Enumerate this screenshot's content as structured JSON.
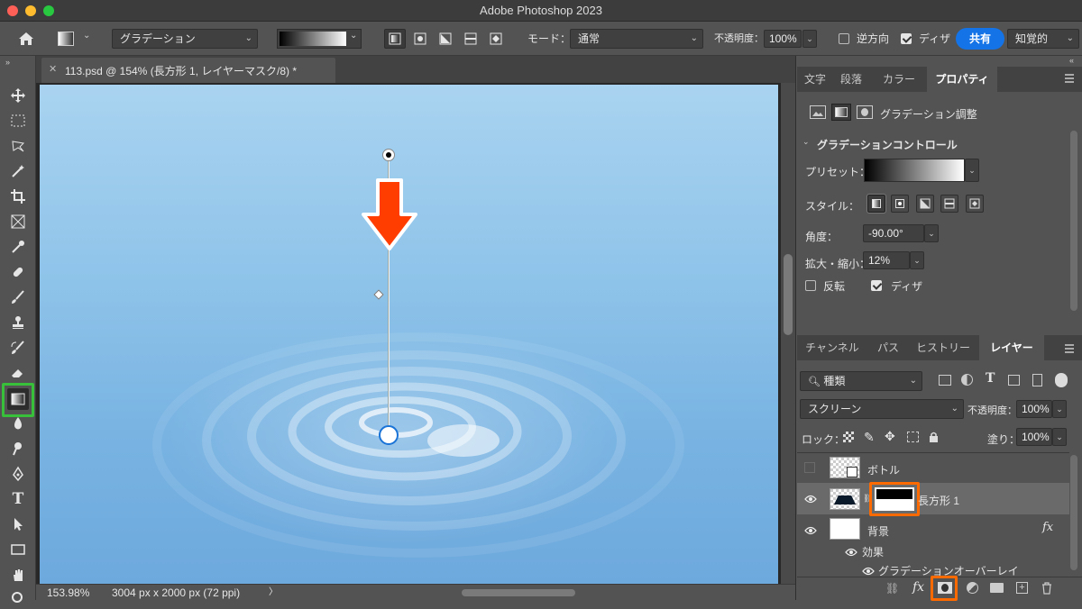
{
  "window": {
    "title": "Adobe Photoshop 2023"
  },
  "options": {
    "gradient_type": "グラデーション",
    "mode_label": "モード：",
    "mode_value": "通常",
    "opacity_label": "不透明度：",
    "opacity_value": "100%",
    "reverse_label": "逆方向",
    "dither_label": "ディザ",
    "share_label": "共有",
    "method_value": "知覚的"
  },
  "document": {
    "tab_title": "113.psd @ 154% (長方形 1, レイヤーマスク/8) *"
  },
  "status": {
    "zoom": "153.98%",
    "size": "3004 px x 2000 px (72 ppi)",
    "arrow": "〉"
  },
  "properties": {
    "tabs": [
      "文字",
      "段落",
      "カラー",
      "プロパティ"
    ],
    "adjustment_label": "グラデーション調整",
    "section_title": "グラデーションコントロール",
    "preset_label": "プリセット：",
    "style_label": "スタイル：",
    "angle_label": "角度：",
    "angle_value": "-90.00°",
    "scale_label": "拡大・縮小：",
    "scale_value": "12%",
    "reverse_label": "反転",
    "dither_label": "ディザ"
  },
  "layers_panel": {
    "tabs": [
      "チャンネル",
      "パス",
      "ヒストリー",
      "レイヤー"
    ],
    "filter_value": "種類",
    "blend_mode": "スクリーン",
    "opacity_label": "不透明度：",
    "opacity_value": "100%",
    "lock_label": "ロック：",
    "fill_label": "塗り：",
    "fill_value": "100%",
    "layers": [
      {
        "name": "ボトル"
      },
      {
        "name": "長方形 1"
      },
      {
        "name": "背景"
      }
    ],
    "effects_label": "効果",
    "effect_item": "グラデーションオーバーレイ",
    "fx_label": "fx"
  },
  "colors": {
    "highlight_orange": "#ff6a00",
    "highlight_green": "#38c03a",
    "share_blue": "#1473e6",
    "arrow_red": "#ff3d00"
  }
}
